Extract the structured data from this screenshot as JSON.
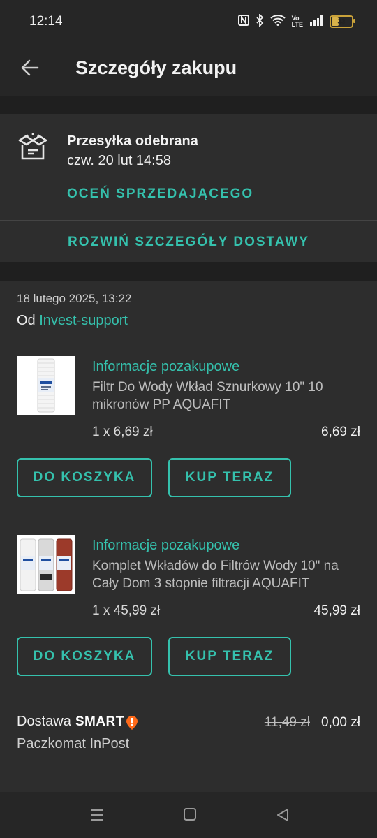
{
  "status_bar": {
    "time": "12:14",
    "battery": "33"
  },
  "header": {
    "title": "Szczegóły zakupu"
  },
  "shipment": {
    "status": "Przesyłka odebrana",
    "date": "czw. 20 lut 14:58",
    "rate_seller": "OCEŃ SPRZEDAJĄCEGO",
    "expand_details": "ROZWIŃ SZCZEGÓŁY DOSTAWY"
  },
  "order": {
    "date": "18 lutego 2025, 13:22",
    "from_prefix": "Od",
    "seller": "Invest-support",
    "items": [
      {
        "info_label": "Informacje pozakupowe",
        "title": "Filtr Do Wody Wkład Sznurkowy 10\" 10 mikronów PP AQUAFIT",
        "quantity": "1 x 6,69 zł",
        "price": "6,69 zł",
        "cart_button": "DO KOSZYKA",
        "buy_button": "KUP TERAZ"
      },
      {
        "info_label": "Informacje pozakupowe",
        "title": "Komplet Wkładów do Filtrów Wody 10\" na Cały Dom 3 stopnie filtracji AQUAFIT",
        "quantity": "1 x 45,99 zł",
        "price": "45,99 zł",
        "cart_button": "DO KOSZYKA",
        "buy_button": "KUP TERAZ"
      }
    ],
    "delivery": {
      "label": "Dostawa",
      "smart": "SMART",
      "method": "Paczkomat InPost",
      "old_price": "11,49 zł",
      "new_price": "0,00 zł"
    }
  },
  "colors": {
    "accent": "#35c1ad",
    "background": "#262626",
    "card": "#2d2d2d",
    "smart_badge": "#ff6a1a"
  },
  "icons": {
    "back": "arrow-left-icon",
    "shipment": "open-box-icon",
    "nav_menu": "menu-icon",
    "nav_home": "home-square-icon",
    "nav_back": "back-triangle-icon"
  }
}
